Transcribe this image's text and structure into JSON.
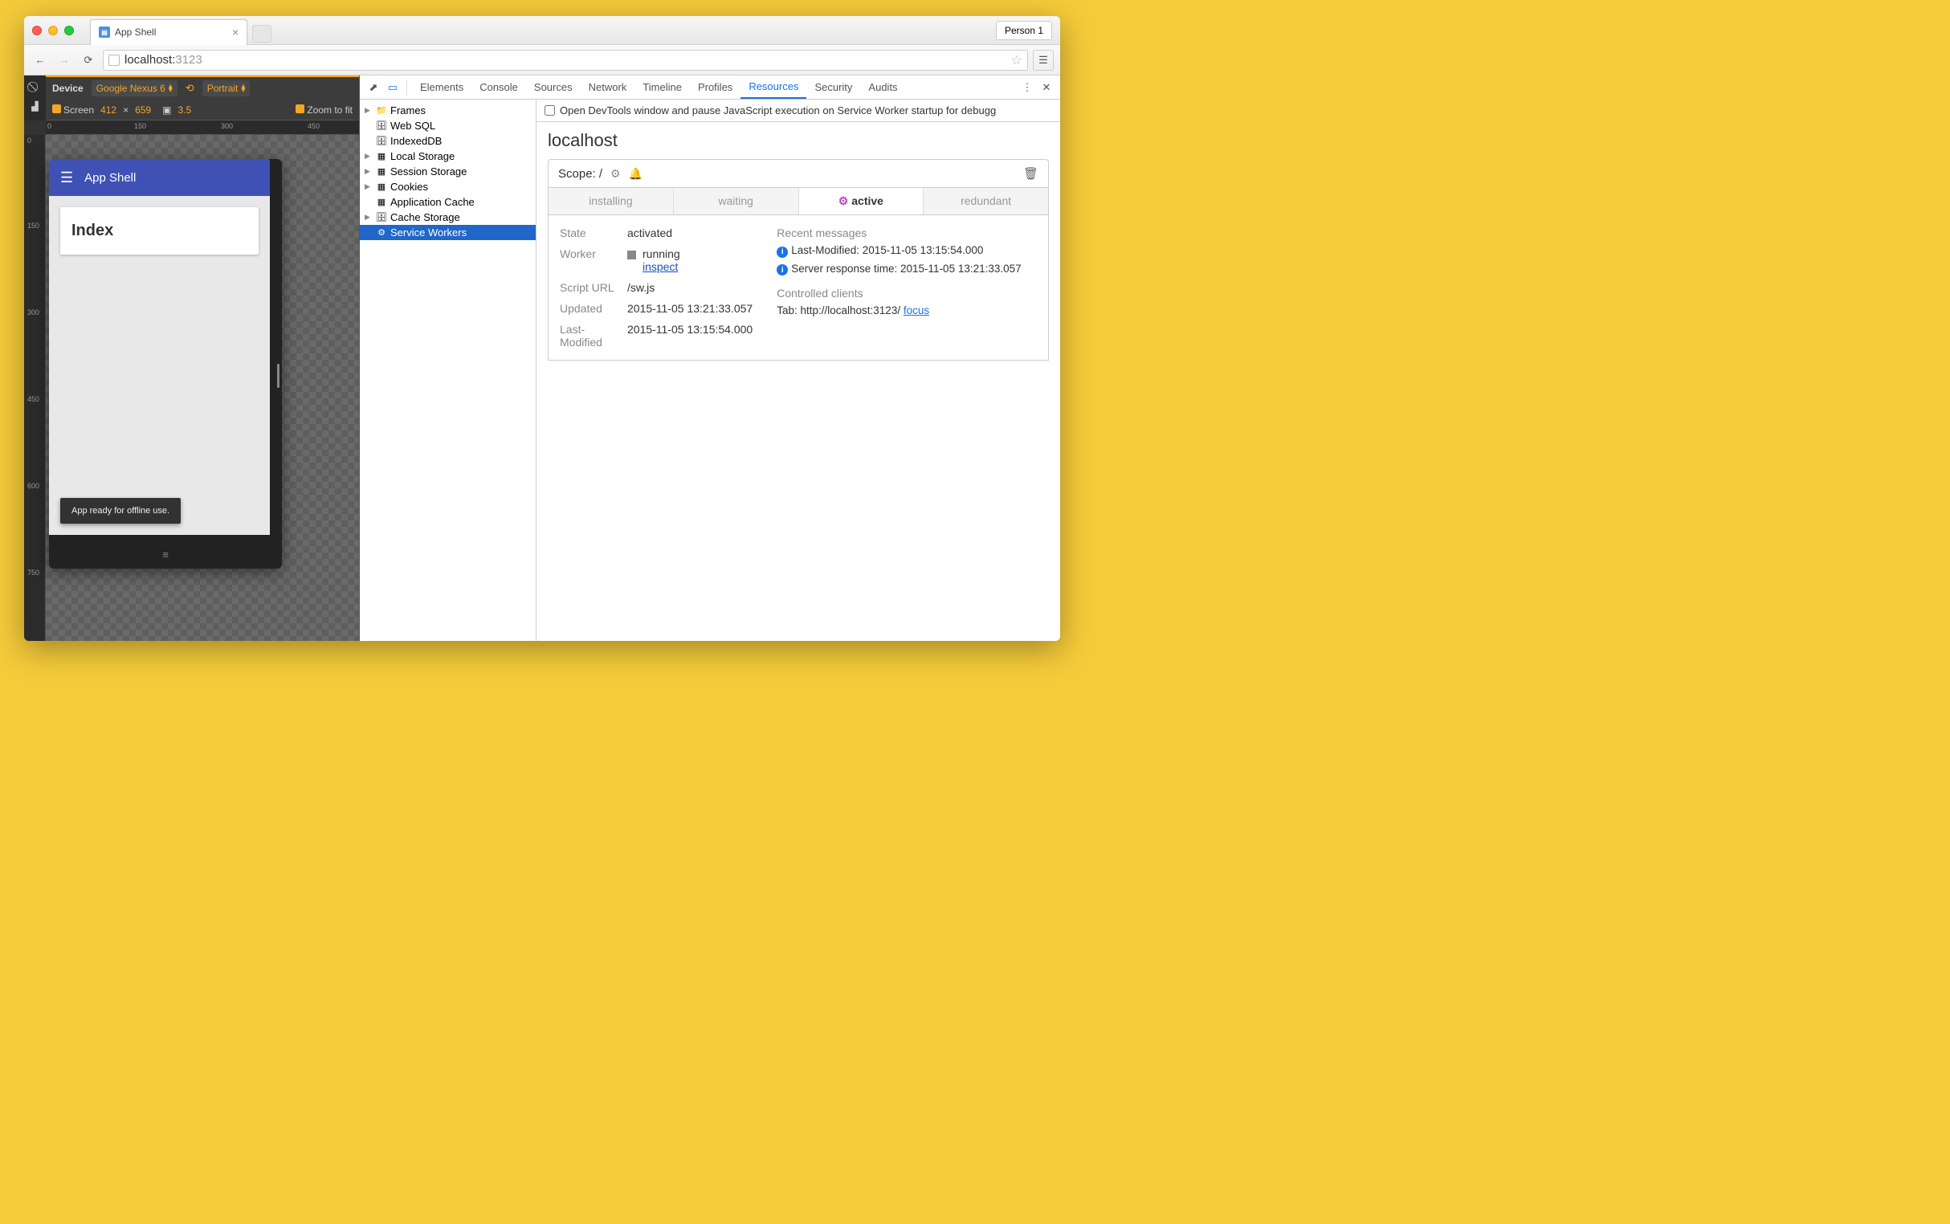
{
  "browser": {
    "tab_title": "App Shell",
    "person_label": "Person 1",
    "url_host": "localhost:",
    "url_port": "3123"
  },
  "device_toolbar": {
    "device_label": "Device",
    "device_value": "Google Nexus 6",
    "orientation": "Portrait",
    "screen_label": "Screen",
    "screen_w": "412",
    "screen_x": "×",
    "screen_h": "659",
    "dpr": "3.5",
    "zoom_label": "Zoom to fit"
  },
  "ruler_h": [
    "0",
    "150",
    "300",
    "450"
  ],
  "ruler_v": [
    "0",
    "150",
    "300",
    "450",
    "600",
    "750"
  ],
  "app": {
    "title": "App Shell",
    "card_heading": "Index",
    "toast": "App ready for offline use."
  },
  "devtools": {
    "tabs": [
      "Elements",
      "Console",
      "Sources",
      "Network",
      "Timeline",
      "Profiles",
      "Resources",
      "Security",
      "Audits"
    ],
    "active_tab": "Resources",
    "tree": [
      {
        "icon": "folder",
        "label": "Frames",
        "arrow": true
      },
      {
        "icon": "db",
        "label": "Web SQL",
        "arrow": false
      },
      {
        "icon": "db",
        "label": "IndexedDB",
        "arrow": false
      },
      {
        "icon": "grid",
        "label": "Local Storage",
        "arrow": true
      },
      {
        "icon": "grid",
        "label": "Session Storage",
        "arrow": true
      },
      {
        "icon": "grid",
        "label": "Cookies",
        "arrow": true
      },
      {
        "icon": "grid",
        "label": "Application Cache",
        "arrow": false
      },
      {
        "icon": "db",
        "label": "Cache Storage",
        "arrow": true
      },
      {
        "icon": "gear",
        "label": "Service Workers",
        "arrow": false,
        "selected": true
      }
    ],
    "option_text": "Open DevTools window and pause JavaScript execution on Service Worker startup for debugg",
    "heading": "localhost",
    "scope_label": "Scope: /",
    "sw_tabs": [
      "installing",
      "waiting",
      "active",
      "redundant"
    ],
    "sw_active": "active",
    "details": {
      "state_k": "State",
      "state_v": "activated",
      "worker_k": "Worker",
      "worker_v": "running",
      "worker_link": "inspect",
      "script_k": "Script URL",
      "script_v": "/sw.js",
      "updated_k": "Updated",
      "updated_v": "2015-11-05 13:21:33.057",
      "lastmod_k": "Last-Modified",
      "lastmod_v": "2015-11-05 13:15:54.000"
    },
    "recent": {
      "heading": "Recent messages",
      "msg1": "Last-Modified: 2015-11-05 13:15:54.000",
      "msg2": "Server response time: 2015-11-05 13:21:33.057",
      "clients_heading": "Controlled clients",
      "client_text": "Tab: http://localhost:3123/ ",
      "client_link": "focus"
    }
  }
}
